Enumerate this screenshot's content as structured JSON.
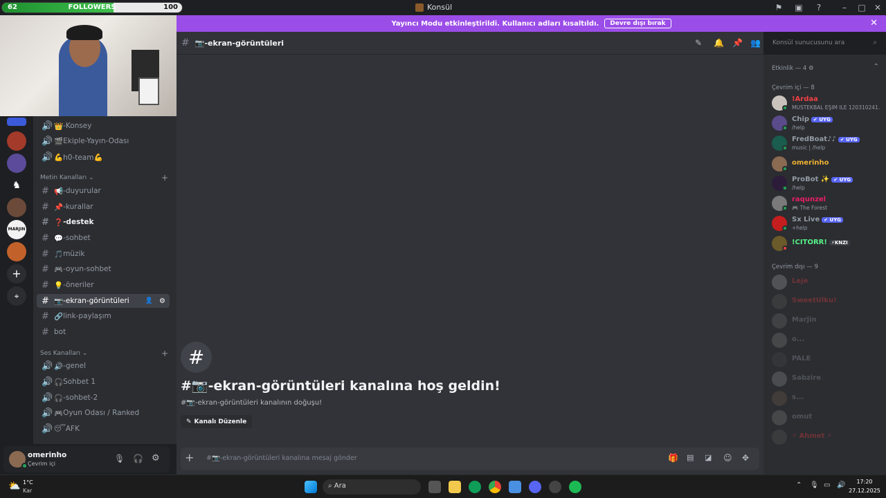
{
  "overlay": {
    "followers_left": "62",
    "followers_label": "FOLLOWERS",
    "followers_right": "100",
    "progress": 0.62
  },
  "window": {
    "title": "Konsül"
  },
  "banner": {
    "text": "Yayıncı Modu etkinleştirildi. Kullanıcı adları kısaltıldı.",
    "button": "Devre dışı bırak"
  },
  "channels": {
    "voice_top": [
      {
        "emoji": "👑",
        "label": "-Konsey"
      },
      {
        "emoji": "🎬",
        "label": "Ekiple-Yayın-Odası"
      },
      {
        "emoji": "💪",
        "label": "h0-team💪"
      }
    ],
    "text_category": "Metin Kanalları",
    "text": [
      {
        "emoji": "📢",
        "label": "-duyurular"
      },
      {
        "emoji": "📌",
        "label": "-kurallar"
      },
      {
        "emoji": "❓",
        "label": "-destek"
      },
      {
        "emoji": "💬",
        "label": "-sohbet"
      },
      {
        "emoji": "🎵",
        "label": "müzik"
      },
      {
        "emoji": "🎮",
        "label": "-oyun-sohbet"
      },
      {
        "emoji": "💡",
        "label": "-öneriler"
      },
      {
        "emoji": "📷",
        "label": "-ekran-görüntüleri"
      },
      {
        "emoji": "🔗",
        "label": "link-paylaşım"
      },
      {
        "emoji": "",
        "label": "bot"
      }
    ],
    "voice_category": "Ses Kanalları",
    "voice": [
      {
        "emoji": "🔊",
        "label": "-genel"
      },
      {
        "emoji": "🎧",
        "label": "Sohbet 1"
      },
      {
        "emoji": "🎧",
        "label": "-sohbet-2"
      },
      {
        "emoji": "🎮",
        "label": "Oyun Odası / Ranked"
      },
      {
        "emoji": "😴",
        "label": "AFK"
      }
    ]
  },
  "user": {
    "name": "omerinho",
    "status": "Çevrim içi"
  },
  "header": {
    "channel": "📷-ekran-görüntüleri",
    "search_placeholder": "Konsül sunucusunu ara"
  },
  "welcome": {
    "title": "#📷-ekran-görüntüleri kanalına hoş geldin!",
    "subtitle": "#📷-ekran-görüntüleri kanalının doğuşu!",
    "edit_button": "Kanalı Düzenle"
  },
  "composer": {
    "placeholder": "#📷-ekran-görüntüleri kanalına mesaj gönder"
  },
  "members": {
    "activity": "Etkinlik — 4",
    "online_header": "Çevrim içi — 8",
    "online": [
      {
        "name": "!Ardaa",
        "status": "MUSTEKBAL EŞIM ILE 120310241...",
        "color": "#f23f43",
        "tag": ""
      },
      {
        "name": "Chip",
        "status": "/help",
        "color": "#949ba4",
        "tag": "✔ UYG"
      },
      {
        "name": "FredBoat♪♪",
        "status": "music | /help",
        "color": "#949ba4",
        "tag": "✔ UYG"
      },
      {
        "name": "omerinho",
        "status": "",
        "color": "#f0b232",
        "tag": ""
      },
      {
        "name": "ProBot ✨",
        "status": "/help",
        "color": "#949ba4",
        "tag": "✔ UYG"
      },
      {
        "name": "raqunzel",
        "status": "🎮 The Forest",
        "color": "#e91e63",
        "tag": ""
      },
      {
        "name": "Sx Live",
        "status": "+help",
        "color": "#949ba4",
        "tag": "✔ UYG"
      },
      {
        "name": "!CITORR!",
        "status": "",
        "color": "#57f287",
        "tag": "⚡KNZI"
      }
    ],
    "offline_header": "Çevrim dışı — 9",
    "offline": [
      {
        "name": "Leje",
        "color": "#f23f43"
      },
      {
        "name": "SweetUlku!",
        "color": "#f23f43"
      },
      {
        "name": "Marjin",
        "color": "#949ba4"
      },
      {
        "name": "o...",
        "color": "#949ba4"
      },
      {
        "name": "PALE",
        "color": "#949ba4"
      },
      {
        "name": "Sabzire",
        "color": "#949ba4"
      },
      {
        "name": "s...",
        "color": "#949ba4"
      },
      {
        "name": "omut",
        "color": "#949ba4"
      },
      {
        "name": "⚡ Ahmet ⚡",
        "color": "#f23f43"
      }
    ]
  },
  "taskbar": {
    "weather_temp": "1°C",
    "weather_text": "Kar",
    "search": "Ara",
    "time": "17:20",
    "date": "27.12.2025"
  }
}
